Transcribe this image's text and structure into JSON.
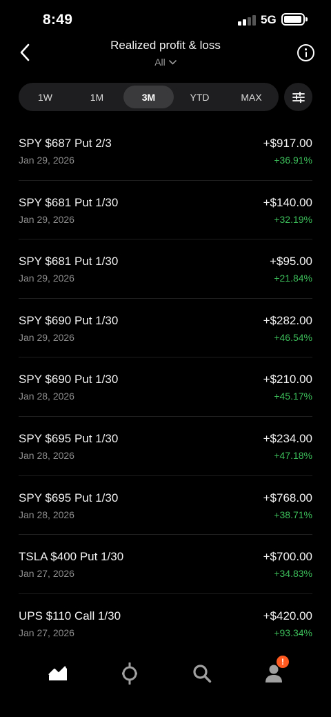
{
  "status_bar": {
    "time": "8:49",
    "network": "5G"
  },
  "header": {
    "title": "Realized profit & loss",
    "filter_label": "All",
    "back_icon": "chevron-left-icon",
    "info_icon": "info-icon"
  },
  "period_tabs": {
    "items": [
      {
        "label": "1W"
      },
      {
        "label": "1M"
      },
      {
        "label": "3M"
      },
      {
        "label": "YTD"
      },
      {
        "label": "MAX"
      }
    ],
    "selected": "3M",
    "settings_icon": "sliders-icon"
  },
  "pl_items": [
    {
      "name": "SPY $687 Put 2/3",
      "date": "Jan 29, 2026",
      "amount": "+$917.00",
      "percent": "+36.91%"
    },
    {
      "name": "SPY $681 Put 1/30",
      "date": "Jan 29, 2026",
      "amount": "+$140.00",
      "percent": "+32.19%"
    },
    {
      "name": "SPY $681 Put 1/30",
      "date": "Jan 29, 2026",
      "amount": "+$95.00",
      "percent": "+21.84%"
    },
    {
      "name": "SPY $690 Put 1/30",
      "date": "Jan 29, 2026",
      "amount": "+$282.00",
      "percent": "+46.54%"
    },
    {
      "name": "SPY $690 Put 1/30",
      "date": "Jan 28, 2026",
      "amount": "+$210.00",
      "percent": "+45.17%"
    },
    {
      "name": "SPY $695 Put 1/30",
      "date": "Jan 28, 2026",
      "amount": "+$234.00",
      "percent": "+47.18%"
    },
    {
      "name": "SPY $695 Put 1/30",
      "date": "Jan 28, 2026",
      "amount": "+$768.00",
      "percent": "+38.71%"
    },
    {
      "name": "TSLA $400 Put 1/30",
      "date": "Jan 27, 2026",
      "amount": "+$700.00",
      "percent": "+34.83%"
    },
    {
      "name": "UPS $110 Call 1/30",
      "date": "Jan 27, 2026",
      "amount": "+$420.00",
      "percent": "+93.34%"
    }
  ],
  "bottom_nav": {
    "items": [
      {
        "icon": "investing-chart-icon"
      },
      {
        "icon": "crypto-icon"
      },
      {
        "icon": "search-icon"
      },
      {
        "icon": "account-icon"
      }
    ],
    "notification_badge": "!"
  },
  "colors": {
    "background": "#000000",
    "gain_green": "#3cbe5a",
    "badge_orange": "#ff5a1f",
    "segment_bg": "#1e1e20",
    "segment_active": "#3a3a3c"
  }
}
